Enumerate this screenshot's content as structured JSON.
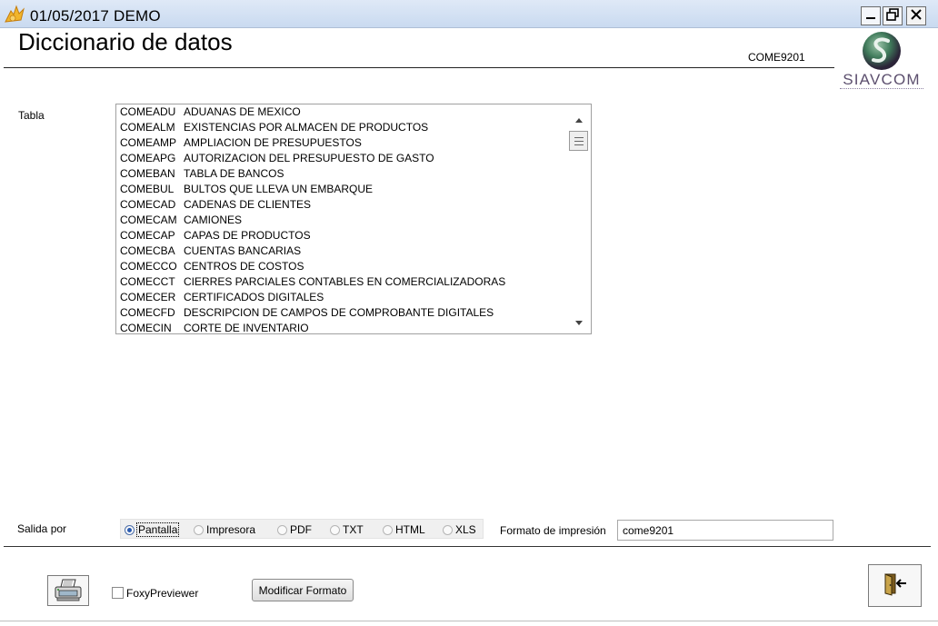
{
  "window": {
    "title": "01/05/2017  DEMO",
    "app_icon": "app-icon",
    "controls": [
      "minimize-icon",
      "restore-icon",
      "close-icon"
    ]
  },
  "header": {
    "title": "Diccionario de datos",
    "form_code": "COME9201",
    "logo_text": "SIAVCOM"
  },
  "tabla": {
    "label": "Tabla",
    "items": [
      {
        "code": "COMEADU",
        "desc": "ADUANAS DE MEXICO"
      },
      {
        "code": "COMEALM",
        "desc": "EXISTENCIAS POR ALMACEN DE PRODUCTOS"
      },
      {
        "code": "COMEAMP",
        "desc": "AMPLIACION DE PRESUPUESTOS"
      },
      {
        "code": "COMEAPG",
        "desc": "AUTORIZACION DEL PRESUPUESTO DE GASTO"
      },
      {
        "code": "COMEBAN",
        "desc": "TABLA DE BANCOS"
      },
      {
        "code": "COMEBUL",
        "desc": "BULTOS QUE LLEVA UN EMBARQUE"
      },
      {
        "code": "COMECAD",
        "desc": "CADENAS DE CLIENTES"
      },
      {
        "code": "COMECAM",
        "desc": "CAMIONES"
      },
      {
        "code": "COMECAP",
        "desc": "CAPAS DE PRODUCTOS"
      },
      {
        "code": "COMECBA",
        "desc": "CUENTAS BANCARIAS"
      },
      {
        "code": "COMECCO",
        "desc": "CENTROS DE COSTOS"
      },
      {
        "code": "COMECCT",
        "desc": "CIERRES PARCIALES CONTABLES EN COMERCIALIZADORAS"
      },
      {
        "code": "COMECER",
        "desc": "CERTIFICADOS DIGITALES"
      },
      {
        "code": "COMECFD",
        "desc": "DESCRIPCION DE CAMPOS DE COMPROBANTE DIGITALES"
      },
      {
        "code": "COMECIN",
        "desc": "CORTE DE INVENTARIO"
      }
    ]
  },
  "salida": {
    "label": "Salida por",
    "options": [
      {
        "label": "Pantalla",
        "checked": true
      },
      {
        "label": "Impresora",
        "checked": false
      },
      {
        "label": "PDF",
        "checked": false
      },
      {
        "label": "TXT",
        "checked": false
      },
      {
        "label": "HTML",
        "checked": false
      },
      {
        "label": "XLS",
        "checked": false
      }
    ]
  },
  "formato": {
    "label": "Formato de impresión",
    "value": "come9201"
  },
  "footer": {
    "print_icon": "printer-icon",
    "foxy_label": "FoxyPreviewer",
    "foxy_checked": false,
    "modify_label": "Modificar Formato",
    "exit_icon": "exit-door-icon"
  }
}
